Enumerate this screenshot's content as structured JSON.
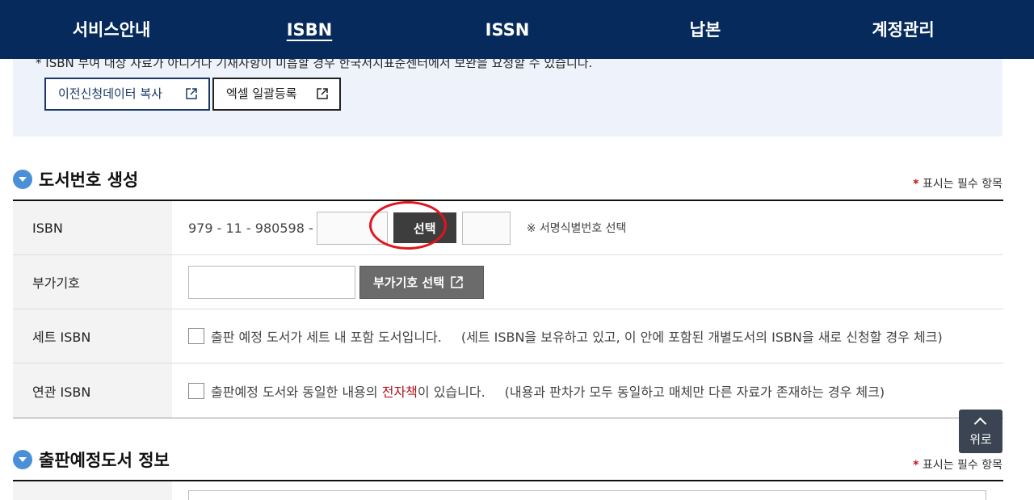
{
  "nav": {
    "items": [
      "서비스안내",
      "ISBN",
      "ISSN",
      "납본",
      "계정관리"
    ],
    "active": "ISBN"
  },
  "info": {
    "notice": "* ISBN 부여 대상 자료가 아니거나 기재사항이 미흡할 경우 한국서지표준센터에서 보완을 요청할 수 있습니다.",
    "copy_button": "이전신청데이터 복사",
    "excel_button": "엑셀 일괄등록"
  },
  "section1": {
    "title": "도서번호 생성",
    "required_note": "표시는 필수 항목"
  },
  "form": {
    "isbn": {
      "label": "ISBN",
      "prefix": "979 - 11 - 980598 -",
      "select_button": "선택",
      "hint": "※ 서명식별번호 선택"
    },
    "addon": {
      "label": "부가기호",
      "select_button": "부가기호 선택"
    },
    "set_isbn": {
      "label": "세트 ISBN",
      "check_text": "출판 예정 도서가 세트 내 포함 도서입니다.",
      "note": "(세트 ISBN을 보유하고 있고, 이 안에 포함된 개별도서의 ISBN을 새로 신청할 경우 체크)"
    },
    "related_isbn": {
      "label": "연관 ISBN",
      "check_text_before": "출판예정 도서와 동일한 내용의 ",
      "check_text_highlight": "전자책",
      "check_text_after": "이 있습니다.",
      "note": "(내용과 판차가 모두 동일하고 매체만 다른 자료가 존재하는 경우 체크)"
    }
  },
  "section2": {
    "title": "출판예정도서 정보",
    "required_note": "표시는 필수 항목"
  },
  "scroll_top": "위로",
  "colors": {
    "nav_bg": "#062a5c",
    "accent_red": "#c0141b",
    "info_bg": "#eef3fb"
  }
}
